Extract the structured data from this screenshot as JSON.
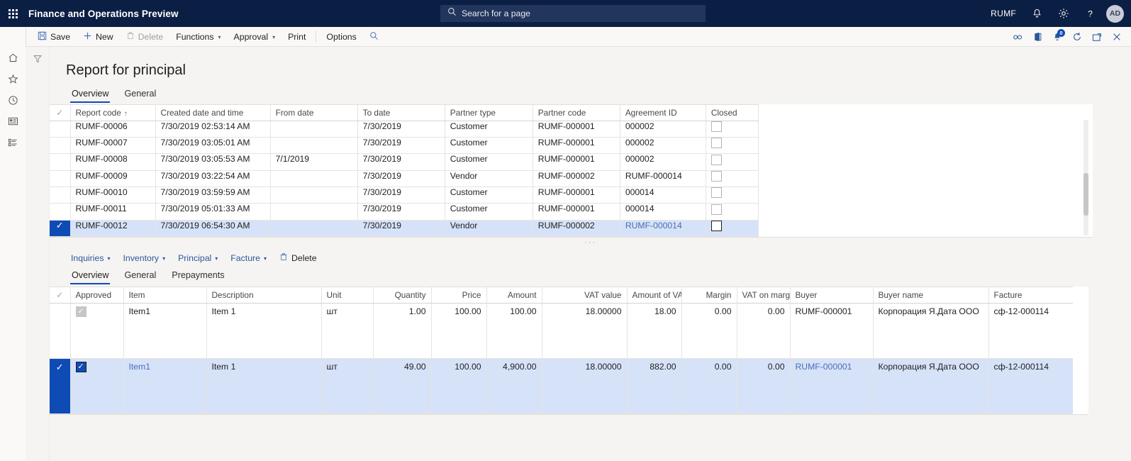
{
  "topbar": {
    "app_title": "Finance and Operations Preview",
    "waffle_icon": "app-launcher-icon",
    "search_placeholder": "Search for a page",
    "search_icon": "search-icon",
    "company": "RUMF",
    "notifications_icon": "bell-icon",
    "settings_icon": "gear-icon",
    "help_icon": "question-mark-icon",
    "avatar_initials": "AD"
  },
  "actionpane": {
    "menu_icon": "hamburger-menu-icon",
    "save": "Save",
    "save_icon": "save-icon",
    "new": "New",
    "new_icon": "plus-icon",
    "delete": "Delete",
    "delete_icon": "trash-icon",
    "functions": "Functions",
    "approval": "Approval",
    "print": "Print",
    "options": "Options",
    "search_icon": "search-icon",
    "attach_icon": "attachment-icon",
    "office_icon": "office-export-icon",
    "notification_icon": "notification-icon",
    "notification_count": "0",
    "refresh_icon": "refresh-icon",
    "popout_icon": "open-in-new-window-icon",
    "close_icon": "close-icon"
  },
  "rail": {
    "items": [
      {
        "name": "home-icon"
      },
      {
        "name": "favorites-star-icon"
      },
      {
        "name": "recent-clock-icon"
      },
      {
        "name": "workspaces-icon"
      },
      {
        "name": "modules-list-icon"
      }
    ],
    "filter_icon": "filter-funnel-icon"
  },
  "page": {
    "title": "Report for principal",
    "tabs": [
      {
        "label": "Overview",
        "active": true
      },
      {
        "label": "General",
        "active": false
      }
    ]
  },
  "header_grid": {
    "columns": [
      {
        "label": "Report code",
        "sorted": "↑"
      },
      {
        "label": "Created date and time"
      },
      {
        "label": "From date"
      },
      {
        "label": "To date"
      },
      {
        "label": "Partner type"
      },
      {
        "label": "Partner code"
      },
      {
        "label": "Agreement ID"
      },
      {
        "label": "Closed"
      }
    ],
    "rows": [
      {
        "selected": false,
        "report_code": "RUMF-00006",
        "created": "7/30/2019 02:53:14 AM",
        "from_date": "",
        "to_date": "7/30/2019",
        "partner_type": "Customer",
        "partner_code": "RUMF-000001",
        "agreement_id": "000002",
        "closed": false
      },
      {
        "selected": false,
        "report_code": "RUMF-00007",
        "created": "7/30/2019 03:05:01 AM",
        "from_date": "",
        "to_date": "7/30/2019",
        "partner_type": "Customer",
        "partner_code": "RUMF-000001",
        "agreement_id": "000002",
        "closed": false
      },
      {
        "selected": false,
        "report_code": "RUMF-00008",
        "created": "7/30/2019 03:05:53 AM",
        "from_date": "7/1/2019",
        "to_date": "7/30/2019",
        "partner_type": "Customer",
        "partner_code": "RUMF-000001",
        "agreement_id": "000002",
        "closed": false
      },
      {
        "selected": false,
        "report_code": "RUMF-00009",
        "created": "7/30/2019 03:22:54 AM",
        "from_date": "",
        "to_date": "7/30/2019",
        "partner_type": "Vendor",
        "partner_code": "RUMF-000002",
        "agreement_id": "RUMF-000014",
        "closed": false
      },
      {
        "selected": false,
        "report_code": "RUMF-00010",
        "created": "7/30/2019 03:59:59 AM",
        "from_date": "",
        "to_date": "7/30/2019",
        "partner_type": "Customer",
        "partner_code": "RUMF-000001",
        "agreement_id": "000014",
        "closed": false
      },
      {
        "selected": false,
        "report_code": "RUMF-00011",
        "created": "7/30/2019 05:01:33 AM",
        "from_date": "",
        "to_date": "7/30/2019",
        "partner_type": "Customer",
        "partner_code": "RUMF-000001",
        "agreement_id": "000014",
        "closed": false
      },
      {
        "selected": true,
        "report_code": "RUMF-00012",
        "created": "7/30/2019 06:54:30 AM",
        "from_date": "",
        "to_date": "7/30/2019",
        "partner_type": "Vendor",
        "partner_code": "RUMF-000002",
        "agreement_id": "RUMF-000014",
        "closed": false
      }
    ]
  },
  "line_toolbar": {
    "inquiries": "Inquiries",
    "inventory": "Inventory",
    "principal": "Principal",
    "facture": "Facture",
    "delete": "Delete",
    "delete_icon": "trash-icon"
  },
  "line_tabs": [
    {
      "label": "Overview",
      "active": true
    },
    {
      "label": "General",
      "active": false
    },
    {
      "label": "Prepayments",
      "active": false
    }
  ],
  "line_grid": {
    "columns": [
      {
        "label": "Approved"
      },
      {
        "label": "Item"
      },
      {
        "label": "Description"
      },
      {
        "label": "Unit"
      },
      {
        "label": "Quantity",
        "align": "right"
      },
      {
        "label": "Price",
        "align": "right"
      },
      {
        "label": "Amount",
        "align": "right"
      },
      {
        "label": "VAT value",
        "align": "right"
      },
      {
        "label": "Amount of VAT",
        "align": "right"
      },
      {
        "label": "Margin",
        "align": "right"
      },
      {
        "label": "VAT on margin",
        "align": "right"
      },
      {
        "label": "Buyer"
      },
      {
        "label": "Buyer name"
      },
      {
        "label": "Facture"
      }
    ],
    "rows": [
      {
        "selected": false,
        "approved": true,
        "item": "Item1",
        "description": "Item 1",
        "unit": "шт",
        "quantity": "1.00",
        "price": "100.00",
        "amount": "100.00",
        "vat_value": "18.00000",
        "amount_of_vat": "18.00",
        "margin": "0.00",
        "vat_on_margin": "0.00",
        "buyer": "RUMF-000001",
        "buyer_name": "Корпорация Я.Дата ООО",
        "facture": "сф-12-000114"
      },
      {
        "selected": true,
        "approved": true,
        "item": "Item1",
        "description": "Item 1",
        "unit": "шт",
        "quantity": "49.00",
        "price": "100.00",
        "amount": "4,900.00",
        "vat_value": "18.00000",
        "amount_of_vat": "882.00",
        "margin": "0.00",
        "vat_on_margin": "0.00",
        "buyer": "RUMF-000001",
        "buyer_name": "Корпорация Я.Дата ООО",
        "facture": "сф-12-000114"
      }
    ]
  },
  "colors": {
    "brand_navy": "#0b1f44",
    "accent_blue": "#0f4bb5",
    "selected_row": "#d6e2f8",
    "link": "#5a7fc4"
  }
}
